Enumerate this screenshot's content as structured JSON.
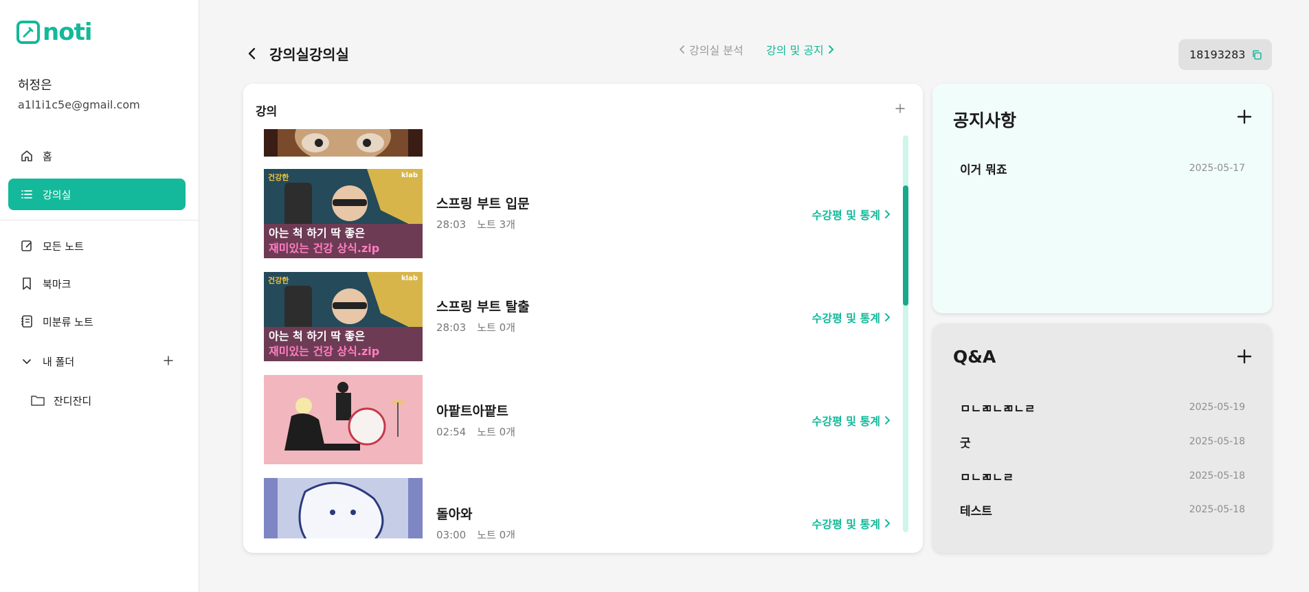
{
  "app": {
    "logo_text": "noti",
    "brand_color": "#13b99a"
  },
  "user": {
    "name": "허정은",
    "email": "a1l1i1c5e@gmail.com"
  },
  "sidebar": {
    "items": [
      {
        "label": "홈",
        "icon": "home-icon"
      },
      {
        "label": "강의실",
        "icon": "list-icon",
        "active": true
      },
      {
        "label": "모든 노트",
        "icon": "note-edit-icon"
      },
      {
        "label": "북마크",
        "icon": "bookmark-icon"
      },
      {
        "label": "미분류 노트",
        "icon": "notebook-icon"
      }
    ],
    "folders": {
      "label": "내 폴더",
      "children": [
        {
          "label": "잔디잔디",
          "icon": "folder-icon"
        }
      ]
    }
  },
  "header": {
    "title": "강의실강의실",
    "prev_tab": "강의실 분석",
    "next_tab": "강의 및 공지",
    "class_code": "18193283"
  },
  "lectures": {
    "title": "강의",
    "stats_label": "수강평 및 통계",
    "items": [
      {
        "title": "",
        "duration": "",
        "notes": ""
      },
      {
        "title": "스프링 부트 입문",
        "duration": "28:03",
        "notes": "노트 3개"
      },
      {
        "title": "스프링 부트 탈출",
        "duration": "28:03",
        "notes": "노트 0개"
      },
      {
        "title": "아팥트아팥트",
        "duration": "02:54",
        "notes": "노트 0개"
      },
      {
        "title": "돌아와",
        "duration": "03:00",
        "notes": "노트 0개"
      }
    ],
    "thumb_caption_1": "아는 척 하기 딱 좋은",
    "thumb_caption_2": "재미있는 건강 상식.zip",
    "thumb_badge": "klab"
  },
  "notices": {
    "title": "공지사항",
    "items": [
      {
        "title": "이거 뭐죠",
        "date": "2025-05-17"
      }
    ]
  },
  "qa": {
    "title": "Q&A",
    "items": [
      {
        "title": "ㅁㄴㄻㄴㄻㄴㄹ",
        "date": "2025-05-19"
      },
      {
        "title": "굿",
        "date": "2025-05-18"
      },
      {
        "title": "ㅁㄴㄻㄴㄹ",
        "date": "2025-05-18"
      },
      {
        "title": "테스트",
        "date": "2025-05-18"
      }
    ]
  }
}
